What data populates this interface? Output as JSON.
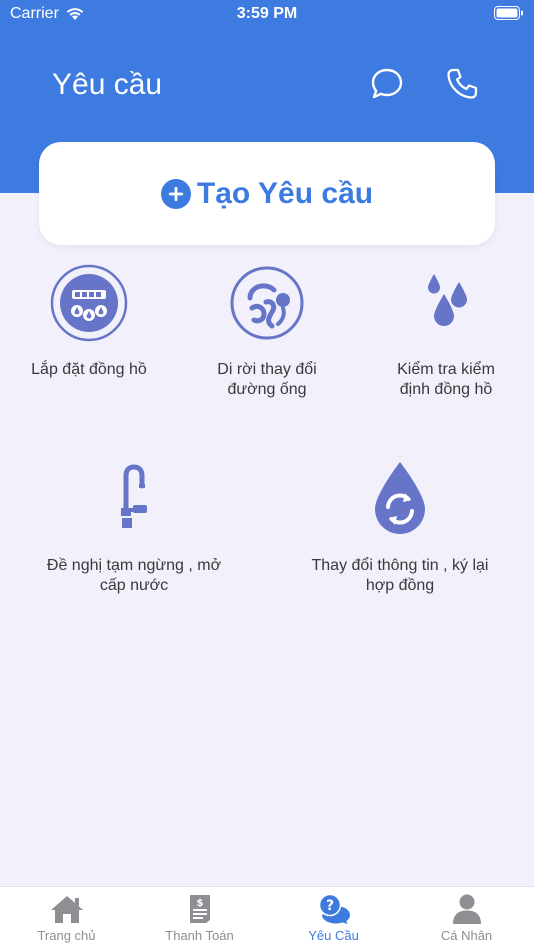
{
  "status_bar": {
    "carrier": "Carrier",
    "time": "3:59 PM"
  },
  "header": {
    "title": "Yêu cầu"
  },
  "create_button": {
    "label": "Tạo Yêu cầu"
  },
  "services": [
    {
      "label": "Lắp đặt đồng hồ",
      "icon": "water-meter-icon"
    },
    {
      "label": "Di rời thay đổi đường ống",
      "icon": "pipe-swirl-icon"
    },
    {
      "label": "Kiểm tra kiểm định đồng hồ",
      "icon": "water-drops-icon"
    },
    {
      "label": "Đề nghị tạm ngừng , mở cấp nước",
      "icon": "faucet-icon"
    },
    {
      "label": "Thay đổi thông tin , ký lại hợp đồng",
      "icon": "drop-refresh-icon"
    }
  ],
  "tabs": [
    {
      "label": "Trang chủ",
      "icon": "home-icon",
      "active": false
    },
    {
      "label": "Thanh Toán",
      "icon": "bill-icon",
      "active": false
    },
    {
      "label": "Yêu Cầu",
      "icon": "question-chat-icon",
      "active": true
    },
    {
      "label": "Cá Nhân",
      "icon": "person-icon",
      "active": false
    }
  ],
  "colors": {
    "primary": "#3d7be0",
    "icon": "#6675c8",
    "background": "#f1f0fb",
    "tab_inactive": "#8e8e93"
  }
}
